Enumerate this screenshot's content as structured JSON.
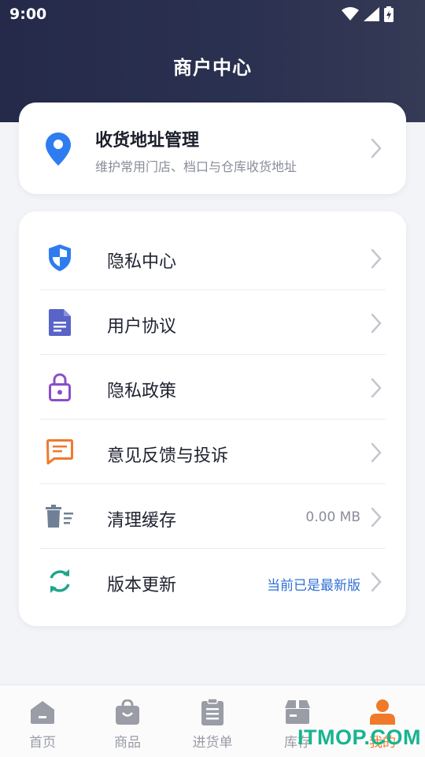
{
  "status_bar": {
    "time": "9:00"
  },
  "header": {
    "title": "商户中心"
  },
  "address_card": {
    "title": "收货地址管理",
    "subtitle": "维护常用门店、档口与仓库收货地址",
    "icon": "location-pin-icon",
    "icon_color": "#2f7cf0"
  },
  "menu": {
    "items": [
      {
        "label": "隐私中心",
        "value": "",
        "icon": "shield-icon",
        "icon_color": "#2f7cf0"
      },
      {
        "label": "用户协议",
        "value": "",
        "icon": "document-icon",
        "icon_color": "#5a63c8"
      },
      {
        "label": "隐私政策",
        "value": "",
        "icon": "lock-icon",
        "icon_color": "#8a4ec8"
      },
      {
        "label": "意见反馈与投诉",
        "value": "",
        "icon": "feedback-icon",
        "icon_color": "#f07a2a"
      },
      {
        "label": "清理缓存",
        "value": "0.00 MB",
        "icon": "trash-icon",
        "icon_color": "#6f8096"
      },
      {
        "label": "版本更新",
        "value": "当前已是最新版",
        "icon": "refresh-icon",
        "icon_color": "#1fa58c"
      }
    ]
  },
  "tabbar": {
    "tabs": [
      {
        "label": "首页",
        "icon": "home-icon",
        "active": false
      },
      {
        "label": "商品",
        "icon": "shopping-bag-icon",
        "active": false
      },
      {
        "label": "进货单",
        "icon": "clipboard-icon",
        "active": false
      },
      {
        "label": "库存",
        "icon": "inventory-box-icon",
        "active": false
      },
      {
        "label": "我的",
        "icon": "user-icon",
        "active": true
      }
    ],
    "active_color": "#f07a2a",
    "inactive_color": "#9a9ca6"
  },
  "watermark": {
    "text": "ITMOP.COM"
  }
}
